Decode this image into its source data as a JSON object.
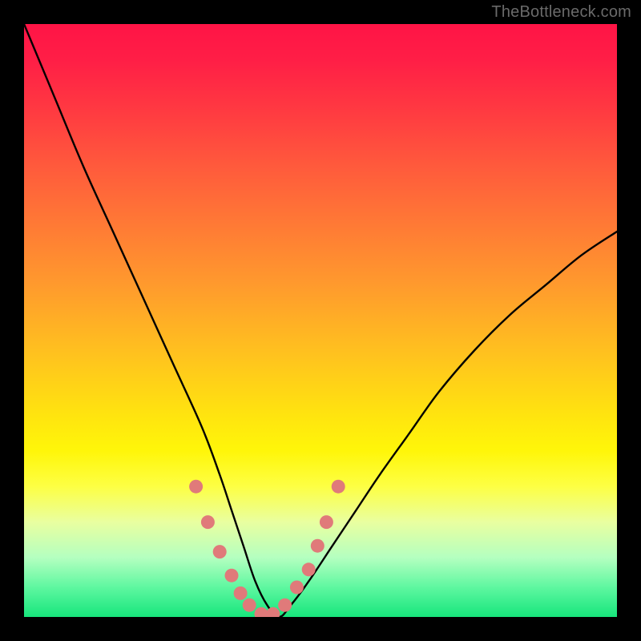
{
  "watermark": {
    "text": "TheBottleneck.com"
  },
  "chart_data": {
    "type": "line",
    "title": "",
    "xlabel": "",
    "ylabel": "",
    "xlim": [
      0,
      100
    ],
    "ylim": [
      0,
      100
    ],
    "grid": false,
    "legend": false,
    "series": [
      {
        "name": "curve",
        "color": "#000000",
        "x": [
          0,
          5,
          10,
          15,
          20,
          25,
          30,
          33,
          35,
          37,
          39,
          41,
          43,
          45,
          48,
          52,
          56,
          60,
          65,
          70,
          76,
          82,
          88,
          94,
          100
        ],
        "values": [
          100,
          88,
          76,
          65,
          54,
          43,
          32,
          24,
          18,
          12,
          6,
          2,
          0,
          2,
          6,
          12,
          18,
          24,
          31,
          38,
          45,
          51,
          56,
          61,
          65
        ]
      },
      {
        "name": "highlight-dots",
        "color": "#e07a7a",
        "x": [
          29,
          31,
          33,
          35,
          36.5,
          38,
          40,
          42,
          44,
          46,
          48,
          49.5,
          51,
          53
        ],
        "values": [
          22,
          16,
          11,
          7,
          4,
          2,
          0.5,
          0.5,
          2,
          5,
          8,
          12,
          16,
          22
        ]
      }
    ],
    "background_gradient": {
      "orientation": "vertical",
      "stops": [
        {
          "offset": 0.0,
          "color": "#ff1446"
        },
        {
          "offset": 0.5,
          "color": "#ffd411"
        },
        {
          "offset": 0.8,
          "color": "#f8ff6a"
        },
        {
          "offset": 1.0,
          "color": "#17e57c"
        }
      ]
    }
  }
}
